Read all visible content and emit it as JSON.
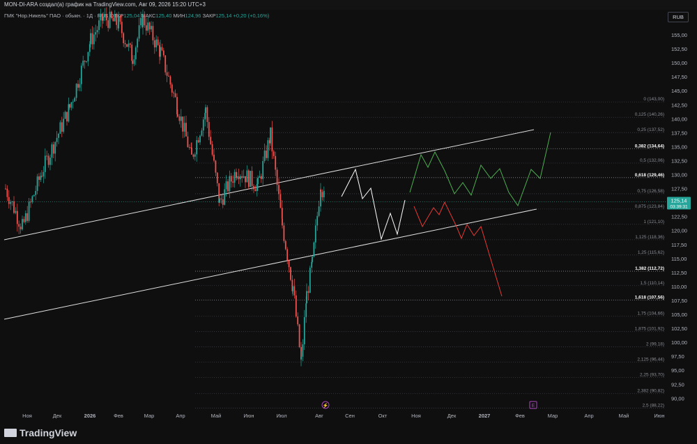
{
  "header": {
    "attribution": "MON-DI-ARA создал(а) график на TradingView.com, Авг 09, 2026 15:20 UTC+3",
    "symbol": "ГМК \"Нор.Никель\" ПАО · обыкн. · 1Д · RUS",
    "open_label": "ОТКР",
    "open_value": "125,04",
    "high_label": "МАКС",
    "high_value": "125,40",
    "low_label": "МИН",
    "low_value": "124,96",
    "close_label": "ЗАКР",
    "close_value": "125,14",
    "change": "+0,20 (+0,16%)",
    "currency": "RUB"
  },
  "price_tag": {
    "price": "125,14",
    "countdown": "03:39:31"
  },
  "footer": {
    "brand": "TradingView"
  },
  "event_markers": {
    "dividend_icon": "lightning-icon",
    "earnings_label": "E"
  },
  "colors": {
    "up": "#26a69a",
    "down": "#ef5350",
    "bullish_path": "#4caf50",
    "bearish_path": "#e53935",
    "neutral_path": "#ffffff",
    "channel": "#e0e0e0"
  },
  "chart_data": {
    "type": "candlestick",
    "y_axis": {
      "range": [
        87.5,
        160.0
      ],
      "scale": "linear",
      "ticks": [
        "155,00",
        "152,50",
        "150,00",
        "147,50",
        "145,00",
        "142,50",
        "140,00",
        "137,50",
        "135,00",
        "132,50",
        "130,00",
        "127,50",
        "125,00",
        "122,50",
        "120,00",
        "117,50",
        "115,00",
        "112,50",
        "110,00",
        "107,50",
        "105,00",
        "102,50",
        "100,00",
        "97,50",
        "95,00",
        "92,50",
        "90,00"
      ]
    },
    "x_axis": {
      "ticks": [
        "Ноя",
        "Дек",
        "2026",
        "Фев",
        "Мар",
        "Апр",
        "Май",
        "Июн",
        "Июл",
        "Авг",
        "Сен",
        "Окт",
        "Ноя",
        "Дек",
        "2027",
        "Фев",
        "Мар",
        "Апр",
        "Май",
        "Июн"
      ]
    },
    "fibonacci": [
      {
        "ratio": "0",
        "price": "143,00",
        "bold": false
      },
      {
        "ratio": "0,125",
        "price": "140,26",
        "bold": false
      },
      {
        "ratio": "0,25",
        "price": "137,52",
        "bold": false
      },
      {
        "ratio": "0,382",
        "price": "134,64",
        "bold": true
      },
      {
        "ratio": "0,5",
        "price": "132,06",
        "bold": false
      },
      {
        "ratio": "0,618",
        "price": "129,46",
        "bold": true
      },
      {
        "ratio": "0,75",
        "price": "126,58",
        "bold": false
      },
      {
        "ratio": "0,875",
        "price": "123,84",
        "bold": false
      },
      {
        "ratio": "1",
        "price": "121,10",
        "bold": false
      },
      {
        "ratio": "1,125",
        "price": "118,36",
        "bold": false
      },
      {
        "ratio": "1,25",
        "price": "115,62",
        "bold": false
      },
      {
        "ratio": "1,382",
        "price": "112,72",
        "bold": true
      },
      {
        "ratio": "1,5",
        "price": "110,14",
        "bold": false
      },
      {
        "ratio": "1,618",
        "price": "107,56",
        "bold": true
      },
      {
        "ratio": "1,75",
        "price": "104,66",
        "bold": false
      },
      {
        "ratio": "1,875",
        "price": "101,92",
        "bold": false
      },
      {
        "ratio": "2",
        "price": "99,18",
        "bold": false
      },
      {
        "ratio": "2,125",
        "price": "96,44",
        "bold": false
      },
      {
        "ratio": "2,25",
        "price": "93,70",
        "bold": false
      },
      {
        "ratio": "2,382",
        "price": "90,82",
        "bold": false
      },
      {
        "ratio": "2,5",
        "price": "88,22",
        "bold": false
      }
    ],
    "price_anchors": [
      {
        "x": "Ноя",
        "y": 127.5
      },
      {
        "x": "Ноя",
        "y": 120.5
      },
      {
        "x": "Дек",
        "y": 130.5
      },
      {
        "x": "Дек",
        "y": 142.0
      },
      {
        "x": "2026",
        "y": 154.0
      },
      {
        "x": "2026",
        "y": 158.0
      },
      {
        "x": "Фев",
        "y": 157.0
      },
      {
        "x": "Фев",
        "y": 151.0
      },
      {
        "x": "Мар",
        "y": 158.0
      },
      {
        "x": "Мар",
        "y": 152.0
      },
      {
        "x": "Апр",
        "y": 142.0
      },
      {
        "x": "Апр",
        "y": 133.0
      },
      {
        "x": "Май",
        "y": 141.5
      },
      {
        "x": "Май",
        "y": 125.0
      },
      {
        "x": "Июн",
        "y": 131.0
      },
      {
        "x": "Июн",
        "y": 128.0
      },
      {
        "x": "Июл",
        "y": 137.0
      },
      {
        "x": "Июл",
        "y": 121.0
      },
      {
        "x": "Июл",
        "y": 110.0
      },
      {
        "x": "Авг",
        "y": 96.5
      },
      {
        "x": "Авг",
        "y": 108.5
      },
      {
        "x": "Авг",
        "y": 114.0
      },
      {
        "x": "Авг",
        "y": 128.5
      },
      {
        "x": "Авг",
        "y": 125.14
      }
    ]
  }
}
